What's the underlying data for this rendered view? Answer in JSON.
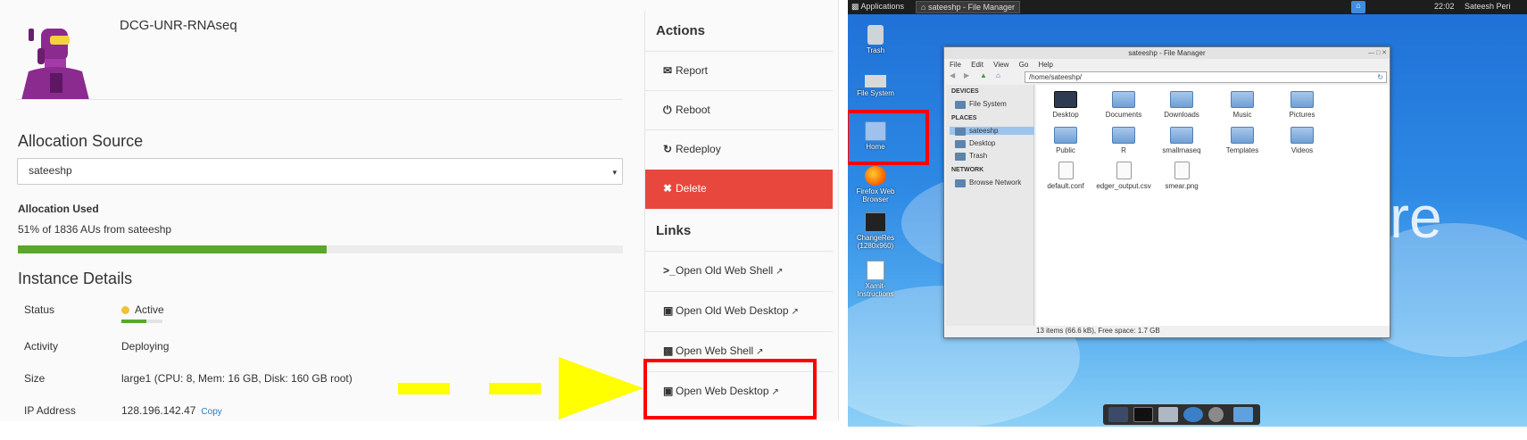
{
  "instance": {
    "name": "DCG-UNR-RNAseq"
  },
  "allocation": {
    "heading": "Allocation Source",
    "selected": "sateeshp",
    "used_heading": "Allocation Used",
    "used_text": "51% of 1836 AUs from sateeshp",
    "used_percent": 51,
    "color_used": "#5aa72a"
  },
  "details": {
    "heading": "Instance Details",
    "status_label": "Status",
    "status_value": "Active",
    "status_progress_percent": 60,
    "activity_label": "Activity",
    "activity_value": "Deploying",
    "size_label": "Size",
    "size_value": "large1 (CPU: 8, Mem: 16 GB, Disk: 160 GB root)",
    "ip_label": "IP Address",
    "ip_value": "128.196.142.47",
    "copy_label": "Copy"
  },
  "actions": {
    "heading": "Actions",
    "items": [
      {
        "icon": "report-icon",
        "label": "Report"
      },
      {
        "icon": "power-icon",
        "label": "Reboot"
      },
      {
        "icon": "redeploy-icon",
        "label": "Redeploy"
      },
      {
        "icon": "delete-icon",
        "label": "Delete"
      }
    ],
    "delete_color": "#e8473d"
  },
  "links": {
    "heading": "Links",
    "items": [
      {
        "icon": "terminal-icon",
        "label": "Open Old Web Shell"
      },
      {
        "icon": "desktop-icon",
        "label": "Open Old Web Desktop"
      },
      {
        "icon": "shell-icon",
        "label": "Open Web Shell"
      },
      {
        "icon": "desktop-icon",
        "label": "Open Web Desktop"
      }
    ]
  },
  "desktop": {
    "topbar": {
      "applications": "Applications",
      "task": "sateeshp - File Manager",
      "clock": "22:02",
      "user": "Sateesh Peri"
    },
    "background_text": "re",
    "icons": [
      "Trash",
      "File System",
      "Home",
      "Firefox Web Browser",
      "ChangeRes (1280x960)",
      "Xamit-Instructions"
    ],
    "file_manager": {
      "title": "sateeshp - File Manager",
      "menu": [
        "File",
        "Edit",
        "View",
        "Go",
        "Help"
      ],
      "path": "/home/sateeshp/",
      "side_devices_h": "DEVICES",
      "side_file_system": "File System",
      "side_places_h": "PLACES",
      "side_home": "sateeshp",
      "side_desktop": "Desktop",
      "side_trash": "Trash",
      "side_network_h": "NETWORK",
      "side_browse": "Browse Network",
      "files": [
        "Desktop",
        "Documents",
        "Downloads",
        "Music",
        "Pictures",
        "Public",
        "R",
        "smallrnaseq",
        "Templates",
        "Videos",
        "default.conf",
        "edger_output.csv",
        "smear.png"
      ],
      "status": "13 items (66.6 kB), Free space: 1.7 GB"
    }
  },
  "annotation_color": "#ffff00",
  "highlight_color": "#ff0000"
}
